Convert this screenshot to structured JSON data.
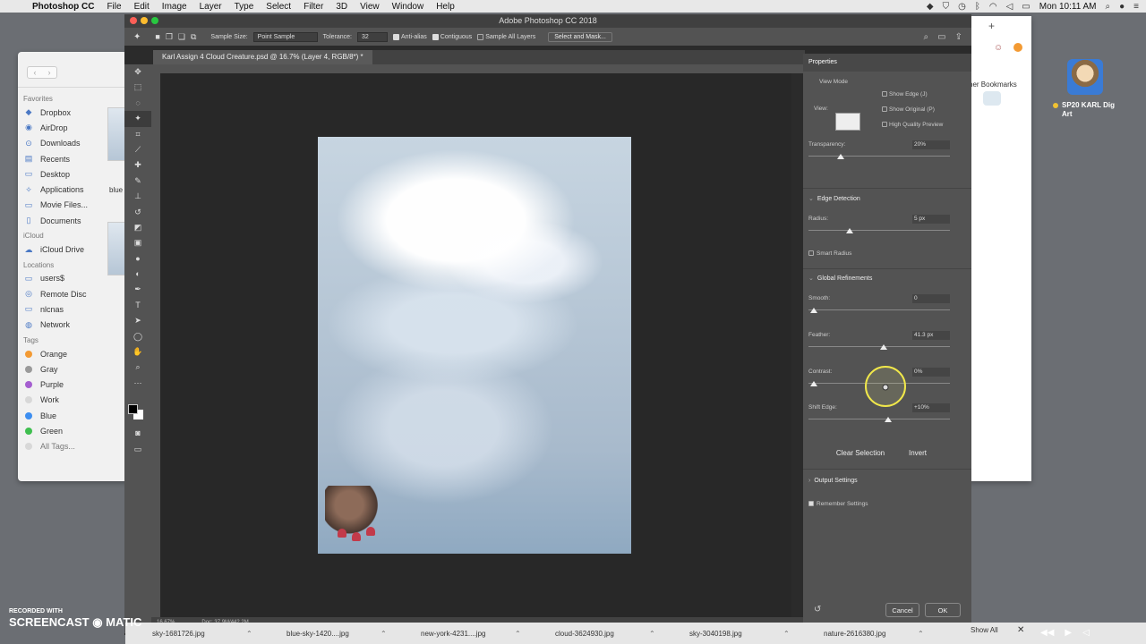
{
  "menubar": {
    "app": "Photoshop CC",
    "items": [
      "File",
      "Edit",
      "Image",
      "Layer",
      "Type",
      "Select",
      "Filter",
      "3D",
      "View",
      "Window",
      "Help"
    ],
    "clock": "Mon 10:11 AM"
  },
  "finder": {
    "favorites_header": "Favorites",
    "favorites": [
      "Dropbox",
      "AirDrop",
      "Downloads",
      "Recents",
      "Desktop",
      "Applications",
      "Movie Files...",
      "Documents"
    ],
    "icloud_header": "iCloud",
    "icloud": [
      "iCloud Drive"
    ],
    "locations_header": "Locations",
    "locations": [
      "users$",
      "Remote Disc",
      "nlcnas",
      "Network"
    ],
    "tags_header": "Tags",
    "tags": [
      {
        "label": "Orange",
        "color": "#f39a33"
      },
      {
        "label": "Gray",
        "color": "#9a9a9a"
      },
      {
        "label": "Purple",
        "color": "#a55fd0"
      },
      {
        "label": "Work",
        "color": "#d8d8d8"
      },
      {
        "label": "Blue",
        "color": "#3d8ef0"
      },
      {
        "label": "Green",
        "color": "#3fbf4f"
      },
      {
        "label": "All Tags...",
        "color": "#d8d8d8"
      }
    ],
    "file_label": "blue"
  },
  "browser": {
    "bookmarks_label": "her Bookmarks"
  },
  "desktop_icon": {
    "label": "SP20 KARL Dig Art"
  },
  "photoshop": {
    "window_title": "Adobe Photoshop CC 2018",
    "options": {
      "sample_size_label": "Sample Size:",
      "sample_size_value": "Point Sample",
      "tolerance_label": "Tolerance:",
      "tolerance_value": "32",
      "anti_alias": "Anti-alias",
      "contiguous": "Contiguous",
      "sample_all_layers": "Sample All Layers",
      "select_and_mask": "Select and Mask..."
    },
    "doc_tab": "Karl Assign 4 Cloud Creature.psd @ 16.7% (Layer 4, RGB/8*) *",
    "status_zoom": "16.67%",
    "status_doc": "Doc: 37.9M/442.2M"
  },
  "properties": {
    "title": "Properties",
    "view_mode": "View Mode",
    "view_label": "View:",
    "show_edge": "Show Edge (J)",
    "show_original": "Show Original (P)",
    "high_quality_preview": "High Quality Preview",
    "transparency_label": "Transparency:",
    "transparency_value": "20%",
    "transparency_level": 0.2,
    "edge_detection": "Edge Detection",
    "radius_label": "Radius:",
    "radius_value": "5 px",
    "smart_radius": "Smart Radius",
    "global_refinements": "Global Refinements",
    "smooth_label": "Smooth:",
    "smooth_value": "0",
    "feather_label": "Feather:",
    "feather_value": "41.3 px",
    "contrast_label": "Contrast:",
    "contrast_value": "0%",
    "shift_edge_label": "Shift Edge:",
    "shift_edge_value": "+10%",
    "clear_selection": "Clear Selection",
    "invert": "Invert",
    "output_settings": "Output Settings",
    "remember_settings": "Remember Settings",
    "cancel": "Cancel",
    "ok": "OK"
  },
  "downloads": {
    "files": [
      "sky-1681726.jpg",
      "blue-sky-1420....jpg",
      "new-york-4231....jpg",
      "cloud-3624930.jpg",
      "sky-3040198.jpg",
      "nature-2616380.jpg"
    ],
    "show_all": "Show All"
  },
  "watermark": {
    "line1": "RECORDED WITH",
    "line2": "SCREENCAST",
    "line3": "MATIC"
  }
}
